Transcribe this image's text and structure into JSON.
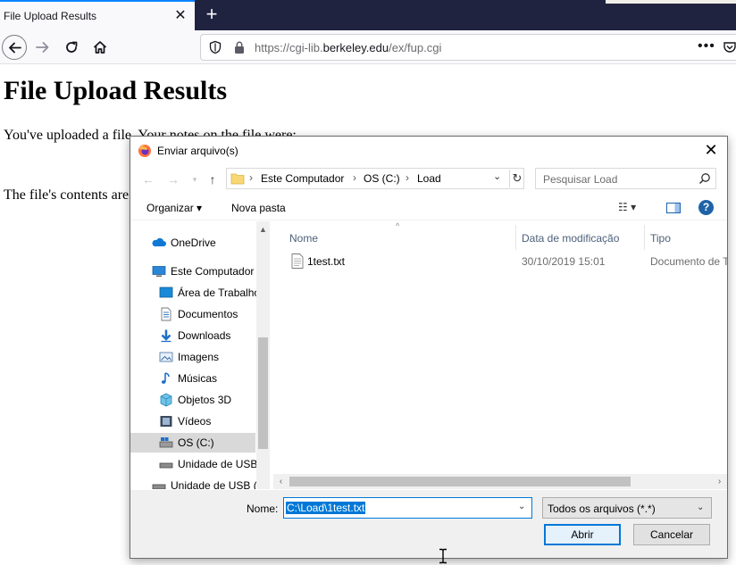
{
  "browser": {
    "tab_title": "File Upload Results",
    "tab_close": "✕",
    "new_tab": "+",
    "url_prefix": "https://cgi-lib.",
    "url_domain": "berkeley.edu",
    "url_path": "/ex/fup.cgi",
    "url_more": "•••"
  },
  "page": {
    "heading": "File Upload Results",
    "line1": "You've uploaded a file. Your notes on the file were:",
    "line2": "The file's contents are:"
  },
  "dialog": {
    "title": "Enviar arquivo(s)",
    "close": "✕",
    "breadcrumbs": [
      "Este Computador",
      "OS (C:)",
      "Load"
    ],
    "search_placeholder": "Pesquisar Load",
    "toolbar": {
      "organize": "Organizar ▾",
      "new_folder": "Nova pasta",
      "view": "☷ ▾",
      "help": "?"
    },
    "nav_items": [
      {
        "label": "OneDrive",
        "icon": "onedrive-icon"
      },
      {
        "label": "Este Computador",
        "icon": "computer-icon"
      },
      {
        "label": "Área de Trabalho",
        "icon": "desktop-icon"
      },
      {
        "label": "Documentos",
        "icon": "documents-icon"
      },
      {
        "label": "Downloads",
        "icon": "downloads-icon"
      },
      {
        "label": "Imagens",
        "icon": "images-icon"
      },
      {
        "label": "Músicas",
        "icon": "music-icon"
      },
      {
        "label": "Objetos 3D",
        "icon": "objects3d-icon"
      },
      {
        "label": "Vídeos",
        "icon": "videos-icon"
      },
      {
        "label": "OS (C:)",
        "icon": "drive-icon",
        "selected": true
      },
      {
        "label": "Unidade de USB",
        "icon": "usb-drive-icon"
      },
      {
        "label": "Unidade de USB (I",
        "icon": "usb-drive-icon"
      }
    ],
    "columns": {
      "name": "Nome",
      "date": "Data de modificação",
      "type": "Tipo"
    },
    "files": [
      {
        "name": "1test.txt",
        "date": "30/10/2019 15:01",
        "type": "Documento de T"
      }
    ],
    "name_label": "Nome:",
    "name_value": "C:\\Load\\1test.txt",
    "filter_value": "Todos os arquivos (*.*)",
    "open_label": "Abrir",
    "cancel_label": "Cancelar"
  },
  "colors": {
    "tabbar": "#1f2340",
    "accent": "#0a84ff",
    "win_blue": "#0078d7"
  }
}
